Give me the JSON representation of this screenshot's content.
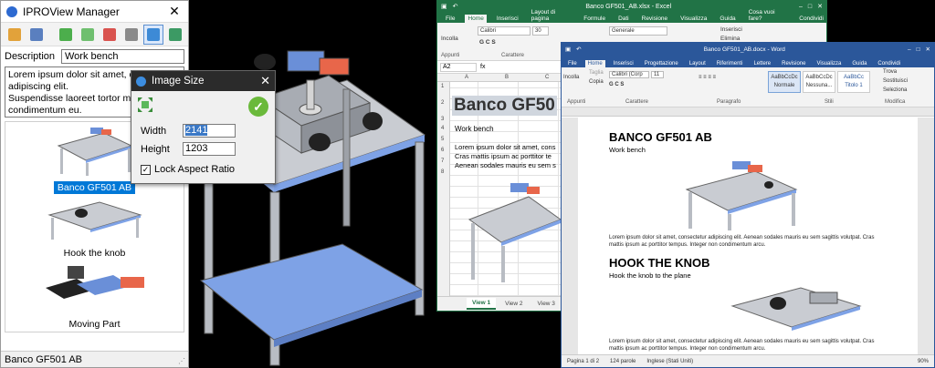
{
  "iproview": {
    "title": "IPROView Manager",
    "description_label": "Description",
    "description_value": "Work bench",
    "memo_text": "Lorem ipsum dolor sit amet, consectetur adipiscing elit.\nSuspendisse laoreet tortor magna, erat condimentum eu.",
    "thumbnails": [
      {
        "caption": "Banco GF501 AB",
        "selected": true
      },
      {
        "caption": "Hook the knob",
        "selected": false
      },
      {
        "caption": "Moving Part",
        "selected": false
      }
    ],
    "status_text": "Banco GF501 AB",
    "toolbar_icons": [
      "open-icon",
      "save-icon",
      "add-image-icon",
      "add-image-alt-icon",
      "delete-image-icon",
      "properties-icon",
      "resize-icon",
      "export-icon"
    ]
  },
  "image_size_dialog": {
    "title": "Image Size",
    "width_label": "Width",
    "width_value": "2141",
    "height_label": "Height",
    "height_value": "1203",
    "lock_label": "Lock Aspect Ratio",
    "lock_checked": true
  },
  "excel": {
    "title": "Banco GF501_AB.xlsx - Excel",
    "tabs": [
      "File",
      "Home",
      "Inserisci",
      "Layout di pagina",
      "Formule",
      "Dati",
      "Revisione",
      "Visualizza",
      "Guida"
    ],
    "tell_me": "Cosa vuoi fare?",
    "share": "Condividi",
    "name_box": "A2",
    "font_name": "Calibri",
    "font_size": "30",
    "number_format": "Generale",
    "group_clipboard": "Appunti",
    "group_font": "Carattere",
    "cell_title": "Banco GF50",
    "cell_sub": "Work bench",
    "cell_lorem": "Lorem ipsum dolor sit amet, cons\nCras mattis ipsum ac porttitor te\nAenean sodales mauris eu sem s",
    "sheets": [
      "View 1",
      "View 2",
      "View 3"
    ],
    "active_sheet": "View 1",
    "col_headers": [
      "A",
      "B",
      "C"
    ],
    "row_headers": [
      "1",
      "2",
      "3",
      "4",
      "5",
      "6",
      "7",
      "8"
    ],
    "paste_label": "Incolla",
    "insert_label": "Inserisci",
    "delete_label": "Elimina"
  },
  "word": {
    "title": "Banco GF501_AB.docx - Word",
    "tabs": [
      "File",
      "Home",
      "Inserisci",
      "Progettazione",
      "Layout",
      "Riferimenti",
      "Lettere",
      "Revisione",
      "Visualizza",
      "Guida"
    ],
    "share": "Condividi",
    "font_name": "Calibri (Corp",
    "font_size": "11",
    "styles": [
      "AaBbCcDc",
      "AaBbCcDc",
      "AaBbCc"
    ],
    "style_names": [
      "Normale",
      "Nessuna...",
      "Titolo 1"
    ],
    "find": "Trova",
    "replace": "Sostituisci",
    "select": "Seleziona",
    "group_clipboard": "Appunti",
    "group_font": "Carattere",
    "group_paragraph": "Paragrafo",
    "group_styles": "Stili",
    "group_edit": "Modifica",
    "paste_label": "Incolla",
    "cut_label": "Taglia",
    "copy_label": "Copia",
    "heading1": "BANCO GF501 AB",
    "sub1": "Work bench",
    "para1": "Lorem ipsum dolor sit amet, consectetur adipiscing elit. Aenean sodales mauris eu sem sagittis volutpat. Cras mattis ipsum ac porttitor tempus. Integer non condimentum arcu.",
    "heading2": "HOOK THE KNOB",
    "sub2": "Hook the knob to the plane",
    "para2": "Lorem ipsum dolor sit amet, consectetur adipiscing elit. Aenean sodales mauris eu sem sagittis volutpat. Cras mattis ipsum ac porttitor tempus. Integer non condimentum arcu.",
    "status_page": "Pagina 1 di 2",
    "status_words": "124 parole",
    "status_lang": "Inglese (Stati Uniti)",
    "zoom": "90%"
  },
  "colors": {
    "excel_green": "#217346",
    "word_blue": "#2b579a",
    "selection_blue": "#0078d7",
    "plate_blue": "#7ea2e6",
    "part_red": "#e8664a"
  }
}
